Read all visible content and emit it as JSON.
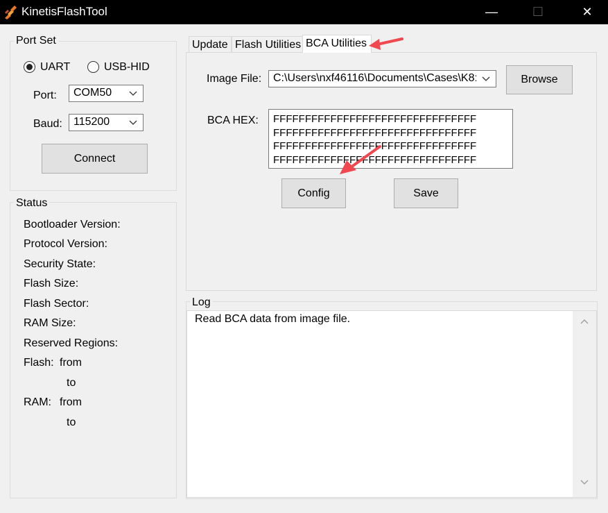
{
  "window": {
    "title": "KinetisFlashTool",
    "minimize": "—",
    "maximize": "☐",
    "close": "✕"
  },
  "port_set": {
    "label": "Port Set",
    "uart": "UART",
    "usb_hid": "USB-HID",
    "port_label": "Port:",
    "port_value": "COM50",
    "baud_label": "Baud:",
    "baud_value": "115200",
    "connect": "Connect"
  },
  "status": {
    "label": "Status",
    "bootloader_version": "Bootloader Version:",
    "protocol_version": "Protocol Version:",
    "security_state": "Security State:",
    "flash_size": "Flash Size:",
    "flash_sector": "Flash Sector:",
    "ram_size": "RAM Size:",
    "reserved_regions": "Reserved Regions:",
    "flash_label": "Flash:",
    "ram_label": "RAM:",
    "from": "from",
    "to": "to"
  },
  "tabs": [
    "Update",
    "Flash Utilities",
    "BCA Utilities"
  ],
  "bca": {
    "image_file_label": "Image File:",
    "image_file_value": "C:\\Users\\nxf46116\\Documents\\Cases\\K8:",
    "browse": "Browse",
    "bca_hex_label": "BCA HEX:",
    "hex_lines": [
      "FFFFFFFFFFFFFFFFFFFFFFFFFFFFFFFF",
      "FFFFFFFFFFFFFFFFFFFFFFFFFFFFFFFF",
      "FFFFFFFFFFFFFFFFFFFFFFFFFFFFFFFF",
      "FFFFFFFFFFFFFFFFFFFFFFFFFFFFFFFF"
    ],
    "config": "Config",
    "save": "Save"
  },
  "log": {
    "label": "Log",
    "text": "Read BCA data from image file."
  },
  "colors": {
    "annotation_arrow": "#f0484e",
    "titlebar": "#000000"
  }
}
